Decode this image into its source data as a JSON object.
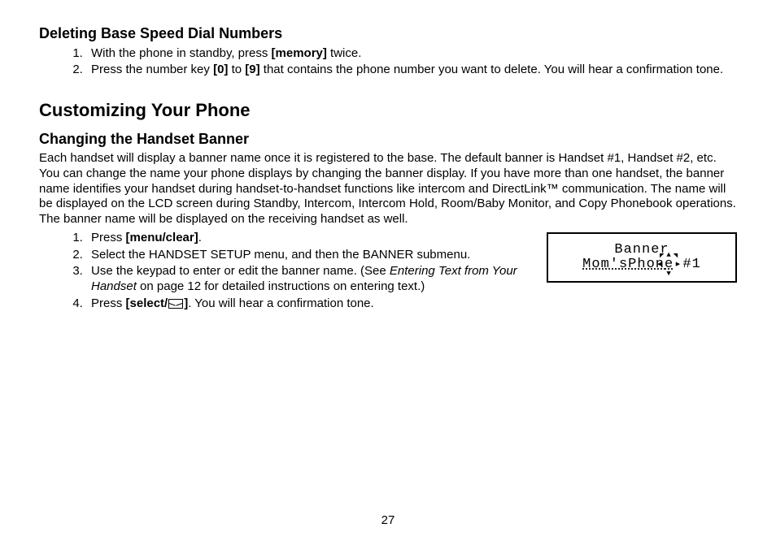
{
  "sectionA": {
    "heading": "Deleting Base Speed Dial Numbers",
    "steps": {
      "s1_a": "With the phone in standby, press ",
      "s1_key": "[memory]",
      "s1_b": " twice.",
      "s2_a": "Press the number key ",
      "s2_key0": "[0]",
      "s2_mid": " to ",
      "s2_key9": "[9]",
      "s2_b": " that contains the phone number you want to delete. You will hear a confirmation tone."
    }
  },
  "sectionB": {
    "heading": "Customizing Your Phone",
    "subheading": "Changing the Handset Banner",
    "paragraph": "Each handset will display a banner name once it is registered to the base. The default banner is Handset #1, Handset #2, etc. You can change the name your phone displays by changing the banner display. If you have more than one handset, the banner name identifies your handset during handset-to-handset functions like intercom and DirectLink™ communication. The name will be displayed on the LCD screen during Standby, Intercom, Intercom Hold, Room/Baby Monitor, and Copy Phonebook operations. The banner name will be displayed on the receiving handset as well.",
    "steps": {
      "s1_a": "Press ",
      "s1_key": "[menu/clear]",
      "s1_b": ".",
      "s2": "Select the HANDSET SETUP menu, and then the BANNER submenu.",
      "s3_a": "Use the keypad  to enter or edit the banner name. (See ",
      "s3_ital": "Entering Text from Your Handset",
      "s3_b": " on page 12 for detailed instructions on entering text.)",
      "s4_a": "Press ",
      "s4_key": "[select/",
      "s4_key_close": "]",
      "s4_b": ". You will hear a confirmation tone."
    }
  },
  "lcd": {
    "line1": "Banner",
    "line2_left": "Mom'sPhon",
    "line2_cursor": "e",
    "line2_right": "#1"
  },
  "pageNumber": "27"
}
